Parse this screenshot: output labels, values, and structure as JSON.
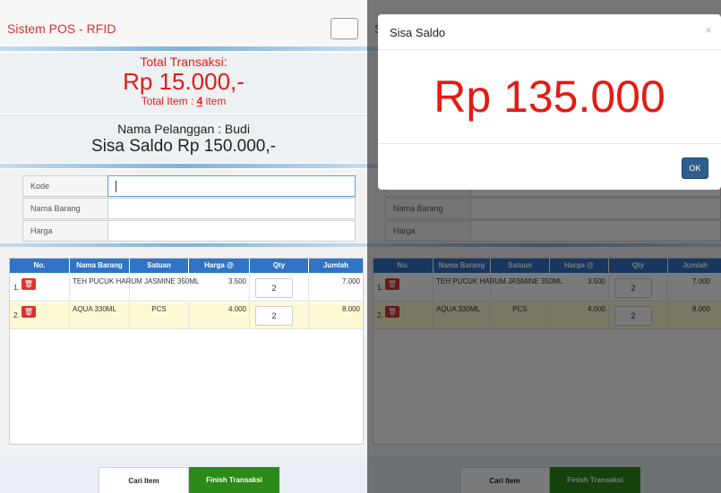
{
  "app": {
    "title": "Sistem POS - RFID"
  },
  "summary": {
    "total_label": "Total Transaksi:",
    "total_amount": "Rp 15.000,-",
    "items_prefix": "Total Item : ",
    "items_count": "4",
    "items_suffix": " item"
  },
  "customer": {
    "name_line": "Nama Pelanggan : Budi",
    "saldo_line": "Sisa Saldo Rp 150.000,-"
  },
  "form": {
    "kode_label": "Kode",
    "kode_value": "",
    "nama_label": "Nama Barang",
    "nama_value": "",
    "harga_label": "Harga",
    "harga_value": ""
  },
  "table": {
    "headers": [
      "No.",
      "Nama Barang",
      "Satuan",
      "Harga @",
      "Qty",
      "Jumlah"
    ],
    "rows": [
      {
        "no": "1.",
        "nama": "TEH PUCUK HARUM JASMINE 350ML",
        "satuan": "",
        "harga": "3.500",
        "qty": "2",
        "jumlah": "7.000"
      },
      {
        "no": "2.",
        "nama": "AQUA 330ML",
        "satuan": "PCS",
        "harga": "4.000",
        "qty": "2",
        "jumlah": "8.000"
      }
    ]
  },
  "buttons": {
    "cari_item": "Cari Item",
    "finish": "Finish Transaksi"
  },
  "modal": {
    "title": "Sisa Saldo",
    "close": "×",
    "amount": "Rp 135.000",
    "ok": "OK"
  },
  "colors": {
    "accent_red": "#e41b14",
    "header_blue": "#3074c8",
    "finish_green": "#2c8a19",
    "ok_blue": "#2d5e8e"
  }
}
